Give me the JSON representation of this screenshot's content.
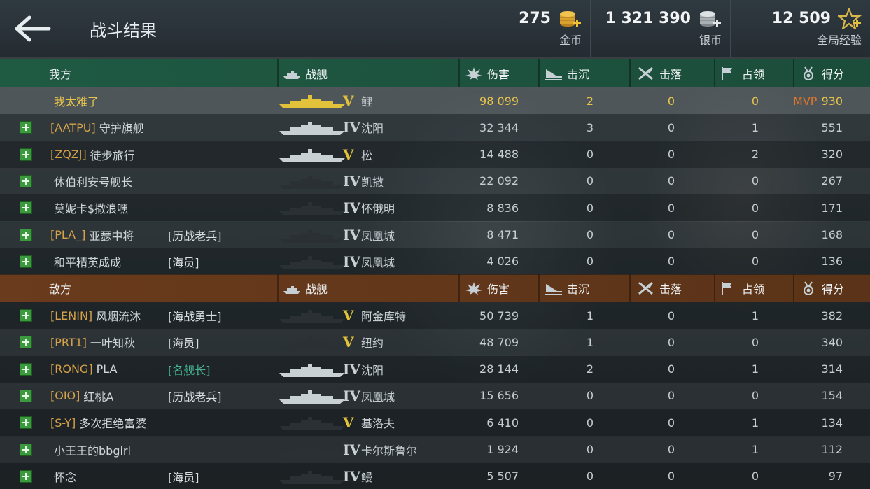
{
  "header": {
    "title": "战斗结果",
    "gold": {
      "value": "275",
      "label": "金币"
    },
    "silver": {
      "value": "1 321 390",
      "label": "银币"
    },
    "xp": {
      "value": "12 509",
      "label": "全局经验"
    }
  },
  "columns": {
    "ship": "战舰",
    "damage": "伤害",
    "sunk": "击沉",
    "shotdown": "击落",
    "capture": "占领",
    "score": "得分"
  },
  "ally": {
    "label": "我方",
    "rows": [
      {
        "clan": "",
        "name": "我太难了",
        "badge": "",
        "tier": "V",
        "ship": "鲤",
        "damage": "98 099",
        "sunk": "2",
        "shotdown": "0",
        "capture": "0",
        "mvp": "MVP",
        "score": "930"
      },
      {
        "clan": "[AATPU]",
        "name": "守护旗舰",
        "badge": "",
        "tier": "IV",
        "ship": "沈阳",
        "damage": "32 344",
        "sunk": "3",
        "shotdown": "0",
        "capture": "1",
        "score": "551"
      },
      {
        "clan": "[ZQZJ]",
        "name": "徒步旅行",
        "badge": "",
        "tier": "V",
        "ship": "松",
        "damage": "14 488",
        "sunk": "0",
        "shotdown": "0",
        "capture": "2",
        "score": "320"
      },
      {
        "clan": "",
        "name": "休伯利安号舰长",
        "badge": "",
        "tier": "IV",
        "ship": "凯撒",
        "damage": "22 092",
        "sunk": "0",
        "shotdown": "0",
        "capture": "0",
        "score": "267"
      },
      {
        "clan": "",
        "name": "莫妮卡$撒浪嘿",
        "badge": "",
        "tier": "IV",
        "ship": "怀俄明",
        "damage": "8 836",
        "sunk": "0",
        "shotdown": "0",
        "capture": "0",
        "score": "171"
      },
      {
        "clan": "[PLA_]",
        "name": "亚瑟中将",
        "badge": "[历战老兵]",
        "tier": "IV",
        "ship": "凤凰城",
        "damage": "8 471",
        "sunk": "0",
        "shotdown": "0",
        "capture": "0",
        "score": "168"
      },
      {
        "clan": "",
        "name": "和平精英成成",
        "badge": "[海员]",
        "tier": "IV",
        "ship": "凤凰城",
        "damage": "4 026",
        "sunk": "0",
        "shotdown": "0",
        "capture": "0",
        "score": "136"
      }
    ]
  },
  "enemy": {
    "label": "敌方",
    "rows": [
      {
        "clan": "[LENIN]",
        "name": "风烟流沐",
        "badge": "[海战勇士]",
        "tier": "V",
        "ship": "阿金库特",
        "damage": "50 739",
        "sunk": "1",
        "shotdown": "0",
        "capture": "1",
        "score": "382"
      },
      {
        "clan": "[PRT1]",
        "name": "一叶知秋",
        "badge": "[海员]",
        "tier": "V",
        "ship": "纽约",
        "damage": "48 709",
        "sunk": "1",
        "shotdown": "0",
        "capture": "0",
        "score": "340"
      },
      {
        "clan": "[RONG]",
        "name": "PLA",
        "badge": "[名舰长]",
        "tier": "IV",
        "ship": "沈阳",
        "damage": "28 144",
        "sunk": "2",
        "shotdown": "0",
        "capture": "1",
        "score": "314"
      },
      {
        "clan": "[OIO]",
        "name": "红桃A",
        "badge": "[历战老兵]",
        "tier": "IV",
        "ship": "凤凰城",
        "damage": "15 656",
        "sunk": "0",
        "shotdown": "0",
        "capture": "0",
        "score": "154"
      },
      {
        "clan": "[S-Y]",
        "name": "多次拒绝富婆",
        "badge": "",
        "tier": "V",
        "ship": "基洛夫",
        "damage": "6 410",
        "sunk": "0",
        "shotdown": "0",
        "capture": "1",
        "score": "134"
      },
      {
        "clan": "",
        "name": "小王王的bbgirl",
        "badge": "",
        "tier": "IV",
        "ship": "卡尔斯鲁尔",
        "damage": "1 924",
        "sunk": "0",
        "shotdown": "0",
        "capture": "1",
        "score": "112"
      },
      {
        "clan": "",
        "name": "怀念",
        "badge": "[海员]",
        "tier": "IV",
        "ship": "鳗",
        "damage": "5 507",
        "sunk": "0",
        "shotdown": "0",
        "capture": "0",
        "score": "97"
      }
    ]
  },
  "colors": {
    "ally_header": "#1f5a43",
    "enemy_header": "#6a3b1c",
    "clan_tag": "#d5a24a",
    "highlight": "#e8c54a",
    "mvp": "#e0762a",
    "title_teal": "#46b492",
    "add_button": "#3c9a3e"
  },
  "icons": {
    "back": "back-arrow-icon",
    "gold": "gold-coins-icon",
    "silver": "silver-coins-icon",
    "xp": "star-plus-icon"
  }
}
